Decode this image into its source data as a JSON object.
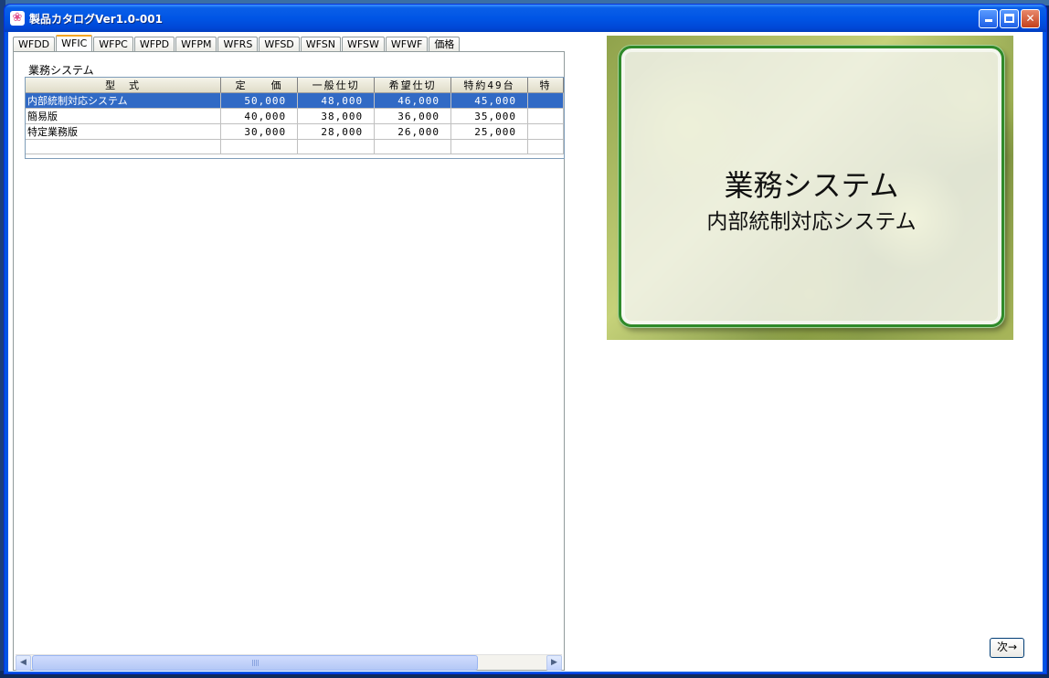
{
  "window": {
    "title": "製品カタログVer1.0-001",
    "app_icon": "sakura-icon",
    "buttons": {
      "minimize": "minimize",
      "maximize": "maximize",
      "close": "✕"
    }
  },
  "tabs": [
    {
      "label": "WFDD",
      "active": false
    },
    {
      "label": "WFIC",
      "active": true
    },
    {
      "label": "WFPC",
      "active": false
    },
    {
      "label": "WFPD",
      "active": false
    },
    {
      "label": "WFPM",
      "active": false
    },
    {
      "label": "WFRS",
      "active": false
    },
    {
      "label": "WFSD",
      "active": false
    },
    {
      "label": "WFSN",
      "active": false
    },
    {
      "label": "WFSW",
      "active": false
    },
    {
      "label": "WFWF",
      "active": false
    },
    {
      "label": "価格",
      "active": false
    }
  ],
  "group_label": "業務システム",
  "grid": {
    "columns": [
      "型　式",
      "定　　価",
      "一般仕切",
      "希望仕切",
      "特約49台",
      "特"
    ],
    "rows": [
      {
        "cells": [
          "内部統制対応システム",
          "50,000",
          "48,000",
          "46,000",
          "45,000",
          ""
        ],
        "selected": true
      },
      {
        "cells": [
          "簡易版",
          "40,000",
          "38,000",
          "36,000",
          "35,000",
          ""
        ],
        "selected": false
      },
      {
        "cells": [
          "特定業務版",
          "30,000",
          "28,000",
          "26,000",
          "25,000",
          ""
        ],
        "selected": false
      },
      {
        "cells": [
          "",
          "",
          "",
          "",
          "",
          ""
        ],
        "selected": false
      }
    ]
  },
  "scrollbar": {
    "left_arrow": "◀",
    "right_arrow": "▶"
  },
  "preview": {
    "title": "業務システム",
    "subtitle": "内部統制対応システム"
  },
  "next_button": "次→"
}
